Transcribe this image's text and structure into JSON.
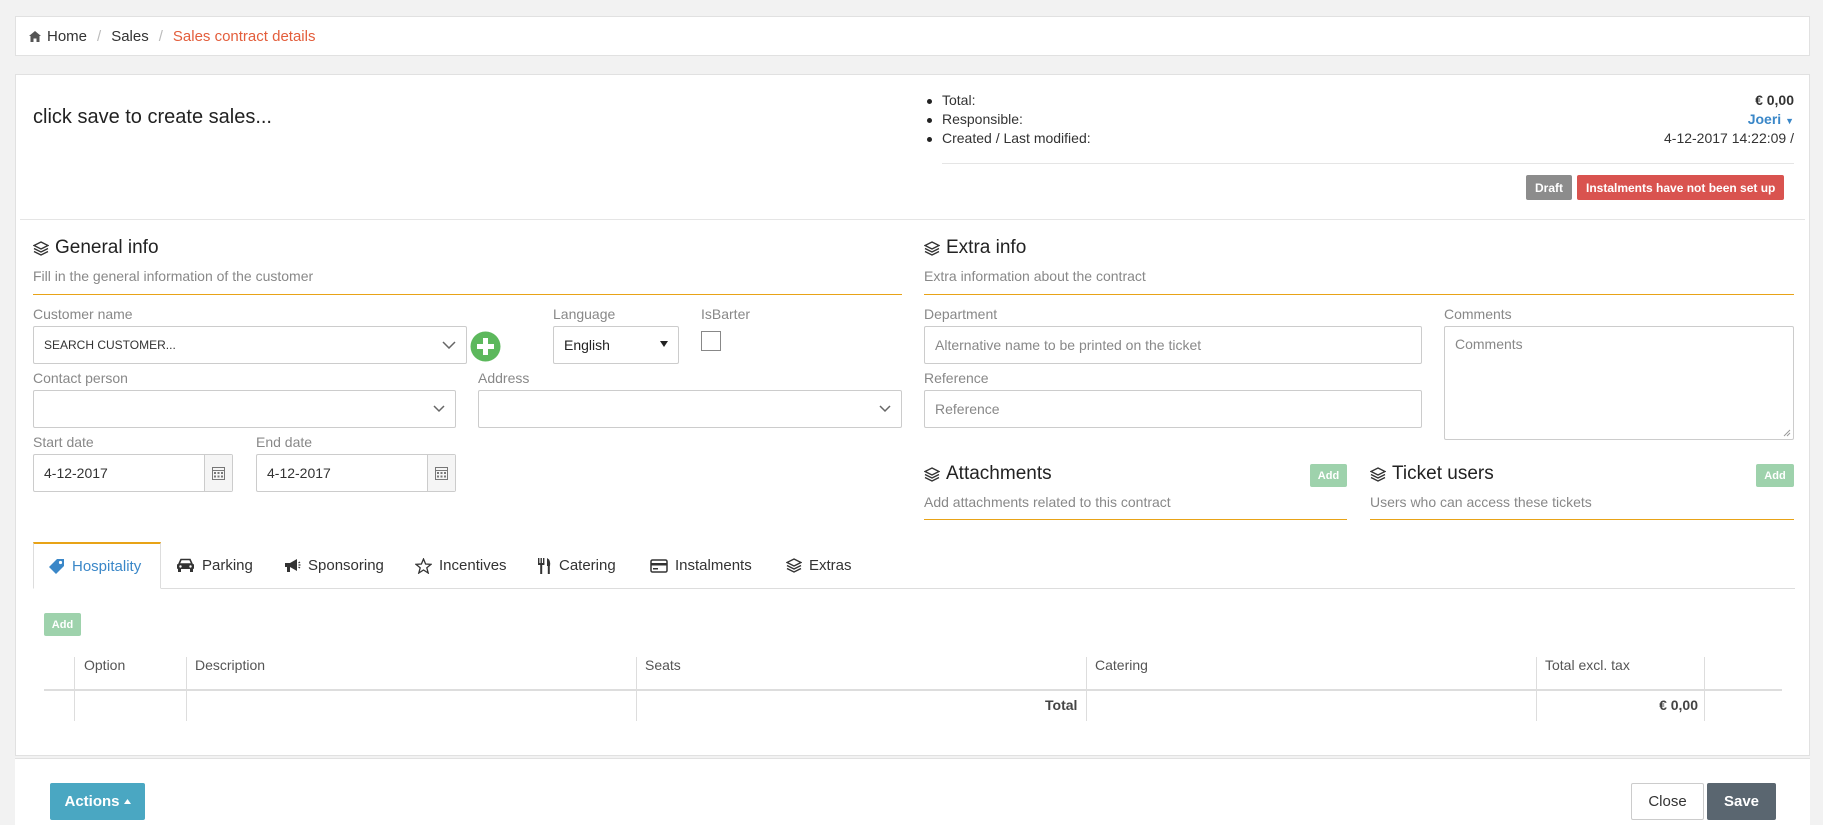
{
  "breadcrumb": {
    "home": "Home",
    "sales": "Sales",
    "current": "Sales contract details"
  },
  "header": {
    "headline": "click save to create sales...",
    "total_label": "Total:",
    "total_value": "€ 0,00",
    "responsible_label": "Responsible:",
    "responsible_value": "Joeri",
    "created_label": "Created / Last modified:",
    "created_value": "4-12-2017 14:22:09 /",
    "badge_draft": "Draft",
    "badge_instalments": "Instalments have not been set up"
  },
  "general_info": {
    "title": "General info",
    "subtitle": "Fill in the general information of the customer",
    "customer_label": "Customer name",
    "customer_value": "SEARCH CUSTOMER...",
    "language_label": "Language",
    "language_value": "English",
    "isbarter_label": "IsBarter",
    "contact_label": "Contact person",
    "address_label": "Address",
    "start_label": "Start date",
    "start_value": "4-12-2017",
    "end_label": "End date",
    "end_value": "4-12-2017"
  },
  "extra_info": {
    "title": "Extra info",
    "subtitle": "Extra information about the contract",
    "department_label": "Department",
    "department_placeholder": "Alternative name to be printed on the ticket",
    "reference_label": "Reference",
    "reference_placeholder": "Reference",
    "comments_label": "Comments",
    "comments_placeholder": "Comments"
  },
  "attachments": {
    "title": "Attachments",
    "subtitle": "Add attachments related to this contract",
    "add_label": "Add"
  },
  "ticket_users": {
    "title": "Ticket users",
    "subtitle": "Users who can access these tickets",
    "add_label": "Add"
  },
  "tabs": [
    {
      "label": "Hospitality",
      "icon": "tag-icon",
      "active": true
    },
    {
      "label": "Parking",
      "icon": "car-icon"
    },
    {
      "label": "Sponsoring",
      "icon": "bullhorn-icon"
    },
    {
      "label": "Incentives",
      "icon": "star-icon"
    },
    {
      "label": "Catering",
      "icon": "cutlery-icon"
    },
    {
      "label": "Instalments",
      "icon": "credit-card-icon"
    },
    {
      "label": "Extras",
      "icon": "layers-icon"
    }
  ],
  "table": {
    "add_label": "Add",
    "columns": [
      "Option",
      "Description",
      "Seats",
      "Catering",
      "Total excl. tax"
    ],
    "total_label": "Total",
    "total_value": "€ 0,00"
  },
  "footer": {
    "actions_label": "Actions",
    "close_label": "Close",
    "save_label": "Save"
  },
  "colors": {
    "accent": "#e8a317",
    "link": "#3a87c8",
    "danger": "#d9534f",
    "success": "#5cb85c",
    "info": "#4aa7c2"
  }
}
